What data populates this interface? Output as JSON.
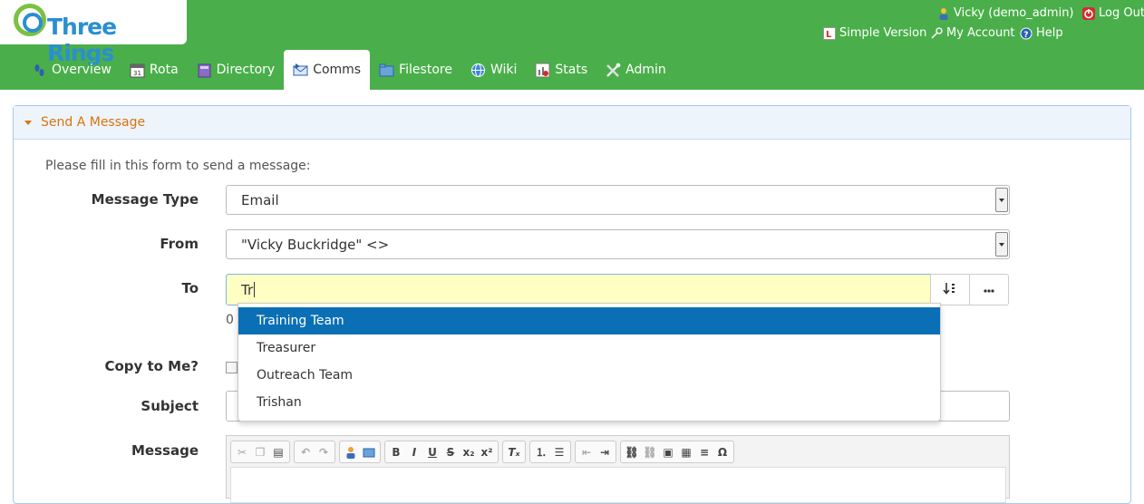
{
  "app": {
    "logo_text": "Three Rings"
  },
  "top_links": {
    "user": "Vicky (demo_admin)",
    "logout": "Log Out",
    "simple_version": "Simple Version",
    "my_account": "My Account",
    "help": "Help"
  },
  "nav": {
    "items": [
      {
        "label": "Overview",
        "icon": "footprints-icon"
      },
      {
        "label": "Rota",
        "icon": "calendar-icon"
      },
      {
        "label": "Directory",
        "icon": "book-icon"
      },
      {
        "label": "Comms",
        "icon": "mail-icon",
        "active": true
      },
      {
        "label": "Filestore",
        "icon": "folder-icon"
      },
      {
        "label": "Wiki",
        "icon": "globe-icon"
      },
      {
        "label": "Stats",
        "icon": "chart-icon"
      },
      {
        "label": "Admin",
        "icon": "tools-icon"
      }
    ]
  },
  "panel": {
    "title": "Send A Message"
  },
  "form": {
    "intro": "Please fill in this form to send a message:",
    "message_type_label": "Message Type",
    "message_type_value": "Email",
    "from_label": "From",
    "from_value": "\"Vicky Buckridge\" <>",
    "to_label": "To",
    "to_value": "Tr",
    "recipient_count": "0",
    "copy_label": "Copy to Me?",
    "subject_label": "Subject",
    "message_label": "Message"
  },
  "autocomplete": {
    "options": [
      "Training Team",
      "Treasurer",
      "Outreach Team",
      "Trishan"
    ],
    "selected_index": 0
  },
  "colors": {
    "header_green": "#4aaf4a",
    "accent_orange": "#d9730d",
    "selection_blue": "#0b6fb5",
    "input_highlight": "#ffffc4"
  }
}
